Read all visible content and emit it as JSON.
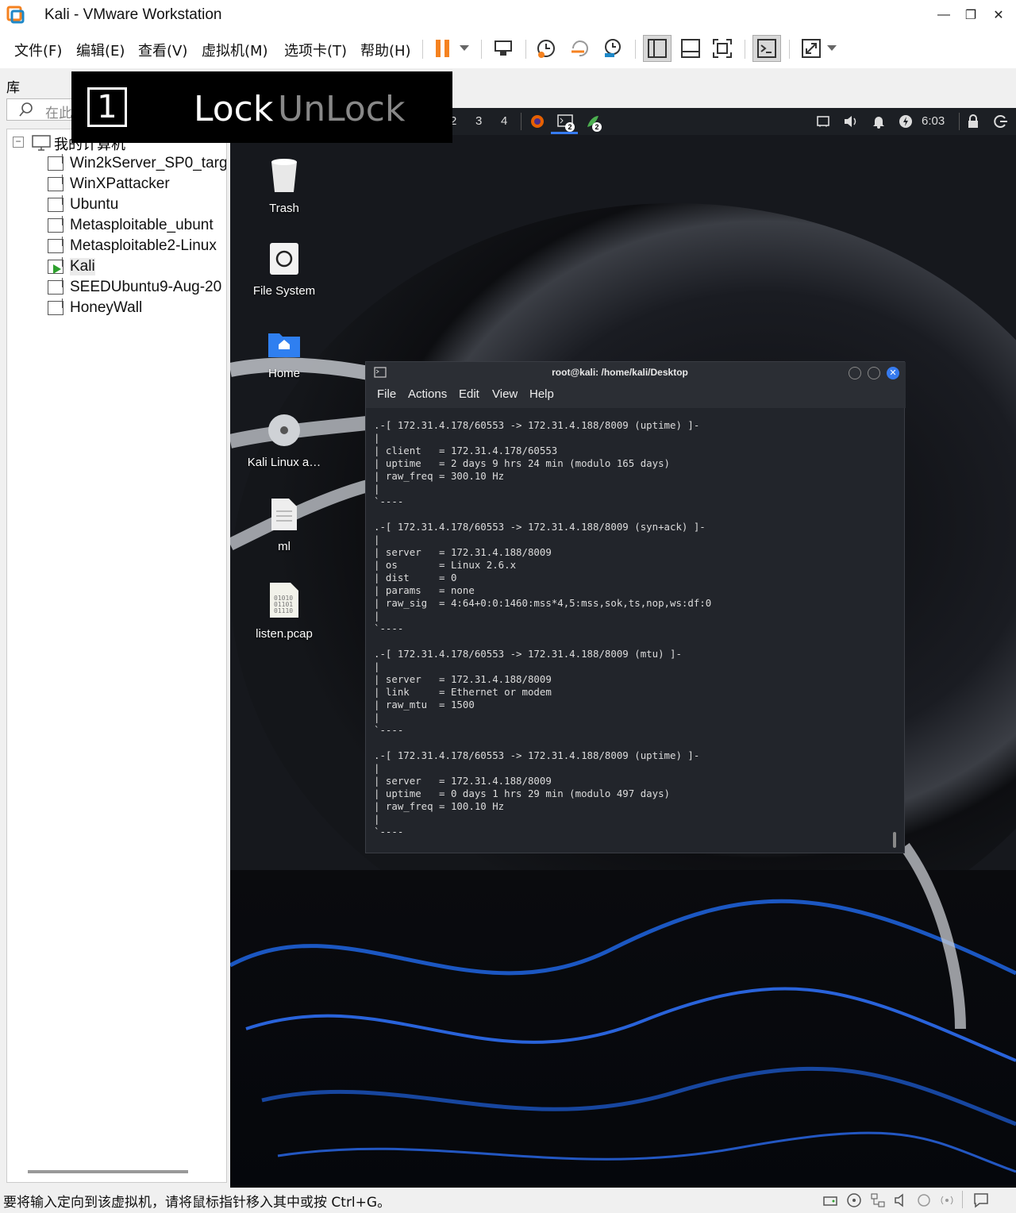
{
  "window": {
    "title": "Kali - VMware Workstation",
    "controls": [
      "minimize",
      "maximize",
      "close"
    ]
  },
  "menubar": {
    "items": [
      "文件(F)",
      "编辑(E)",
      "查看(V)",
      "虚拟机(M)",
      "选项卡(T)",
      "帮助(H)"
    ]
  },
  "toolbar": {
    "icons": [
      "pause-icon",
      "dropdown-icon",
      "send-ctrl-alt-del-icon",
      "snapshot-icon",
      "revert-snapshot-icon",
      "snapshot-manager-icon",
      "show-library-icon",
      "thumbnail-icon",
      "fullscreen-icon",
      "console-view-icon",
      "stretch-icon"
    ]
  },
  "library": {
    "title": "库",
    "search_placeholder": "在此",
    "root": "我的计算机",
    "vms": [
      "Win2kServer_SP0_targ",
      "WinXPattacker",
      "Ubuntu",
      "Metasploitable_ubunt",
      "Metasploitable2-Linux",
      "Kali",
      "SEEDUbuntu9-Aug-20",
      "HoneyWall"
    ],
    "selected": "Kali"
  },
  "lock_overlay": {
    "number": "1",
    "lock": "Lock",
    "unlock": "UnLock"
  },
  "kali_panel": {
    "workspaces": [
      "2",
      "3",
      "4"
    ],
    "badge": "2",
    "clock": "6:03"
  },
  "desktop": {
    "icons": [
      "Trash",
      "File System",
      "Home",
      "Kali Linux a…",
      "ml",
      "listen.pcap"
    ]
  },
  "terminal": {
    "title": "root@kali: /home/kali/Desktop",
    "menu": [
      "File",
      "Actions",
      "Edit",
      "View",
      "Help"
    ],
    "lines": [
      ".-[ 172.31.4.178/60553 -> 172.31.4.188/8009 (uptime) ]-",
      "|",
      "| client   = 172.31.4.178/60553",
      "| uptime   = 2 days 9 hrs 24 min (modulo 165 days)",
      "| raw_freq = 300.10 Hz",
      "|",
      "`----",
      "",
      ".-[ 172.31.4.178/60553 -> 172.31.4.188/8009 (syn+ack) ]-",
      "|",
      "| server   = 172.31.4.188/8009",
      "| os       = Linux 2.6.x",
      "| dist     = 0",
      "| params   = none",
      "| raw_sig  = 4:64+0:0:1460:mss*4,5:mss,sok,ts,nop,ws:df:0",
      "|",
      "`----",
      "",
      ".-[ 172.31.4.178/60553 -> 172.31.4.188/8009 (mtu) ]-",
      "|",
      "| server   = 172.31.4.188/8009",
      "| link     = Ethernet or modem",
      "| raw_mtu  = 1500",
      "|",
      "`----",
      "",
      ".-[ 172.31.4.178/60553 -> 172.31.4.188/8009 (uptime) ]-",
      "|",
      "| server   = 172.31.4.188/8009",
      "| uptime   = 0 days 1 hrs 29 min (modulo 497 days)",
      "| raw_freq = 100.10 Hz",
      "|",
      "`----"
    ]
  },
  "statusbar": {
    "text": "要将输入定向到该虚拟机，请将鼠标指针移入其中或按 Ctrl+G。"
  },
  "colors": {
    "accent": "#3b82f6",
    "pause": "#f58220",
    "terminal_bg": "#22252b"
  }
}
